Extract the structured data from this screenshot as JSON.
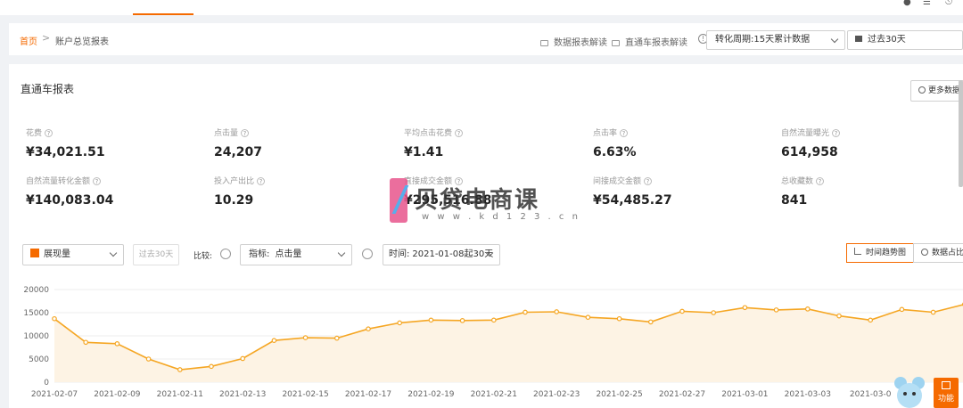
{
  "breadcrumb": {
    "home": "首页",
    "separator": ">",
    "current": "账户总览报表"
  },
  "header_links": [
    {
      "label": "数据报表解读"
    },
    {
      "label": "直通车报表解读"
    }
  ],
  "conversion_period": {
    "selected": "转化周期:15天累计数据"
  },
  "date_range": {
    "selected": "过去30天"
  },
  "panel": {
    "title": "直通车报表",
    "more_button": "更多数据"
  },
  "metrics_row1": [
    {
      "label": "花费",
      "value": "¥34,021.51"
    },
    {
      "label": "点击量",
      "value": "24,207"
    },
    {
      "label": "平均点击花费",
      "value": "¥1.41"
    },
    {
      "label": "点击率",
      "value": "6.63%"
    },
    {
      "label": "自然流量曝光",
      "value": "614,958"
    }
  ],
  "metrics_row2": [
    {
      "label": "自然流量转化金额",
      "value": "¥140,083.04"
    },
    {
      "label": "投入产出比",
      "value": "10.29"
    },
    {
      "label": "直接成交金额",
      "value": "¥295,516.88"
    },
    {
      "label": "间接成交金额",
      "value": "¥54,485.27"
    },
    {
      "label": "总收藏数",
      "value": "841"
    }
  ],
  "controls": {
    "metric_select": "展现量",
    "past_button": "过去30天",
    "compare_label": "比较:",
    "indicator_prefix": "指标:",
    "indicator_value": "点击量",
    "time_prefix": "时间:",
    "time_value": "2021-01-08起30天",
    "view_trend": "时间趋势图",
    "view_share": "数据占比"
  },
  "watermark": {
    "brand": "贝贷电商课",
    "url": "w w w . k d 1 2 3 . c n"
  },
  "float_button": "功能",
  "colors": {
    "accent": "#f56a00",
    "line": "#f5a623",
    "area": "#fdf3e4"
  },
  "chart_data": {
    "type": "area",
    "y_ticks": [
      "0",
      "5000",
      "10000",
      "15000",
      "20000"
    ],
    "ylim": [
      0,
      20000
    ],
    "x_tick_labels": [
      "2021-02-07",
      "2021-02-09",
      "2021-02-11",
      "2021-02-13",
      "2021-02-15",
      "2021-02-17",
      "2021-02-19",
      "2021-02-21",
      "2021-02-23",
      "2021-02-25",
      "2021-02-27",
      "2021-03-01",
      "2021-03-03",
      "2021-03-0"
    ],
    "x": [
      "2021-02-07",
      "2021-02-08",
      "2021-02-09",
      "2021-02-10",
      "2021-02-11",
      "2021-02-12",
      "2021-02-13",
      "2021-02-14",
      "2021-02-15",
      "2021-02-16",
      "2021-02-17",
      "2021-02-18",
      "2021-02-19",
      "2021-02-20",
      "2021-02-21",
      "2021-02-22",
      "2021-02-23",
      "2021-02-24",
      "2021-02-25",
      "2021-02-26",
      "2021-02-27",
      "2021-02-28",
      "2021-03-01",
      "2021-03-02",
      "2021-03-03",
      "2021-03-04",
      "2021-03-05",
      "2021-03-06",
      "2021-03-07"
    ],
    "values": [
      13700,
      8600,
      8300,
      5000,
      2700,
      3400,
      5100,
      9000,
      9600,
      9500,
      11500,
      12800,
      13400,
      13300,
      13400,
      15100,
      15200,
      14000,
      13700,
      13000,
      15300,
      15000,
      16100,
      15600,
      15800,
      14300,
      13400,
      15700,
      15100,
      16800
    ]
  }
}
